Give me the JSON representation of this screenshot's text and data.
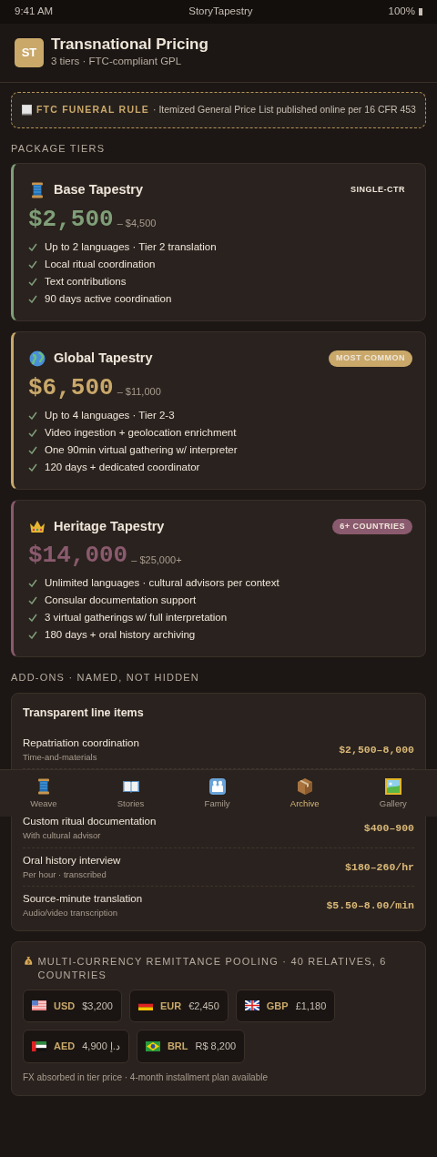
{
  "status_bar": {
    "time": "9:41 AM",
    "app": "StoryTapestry",
    "battery": "100%"
  },
  "header": {
    "avatar": "ST",
    "title": "Transnational Pricing",
    "subtitle": "3 tiers · FTC-compliant GPL"
  },
  "notice": {
    "label": "FTC FUNERAL RULE",
    "text": "· Itemized General Price List published online per 16 CFR 453"
  },
  "tiers_heading": "PACKAGE TIERS",
  "tiers": [
    {
      "kind": "spool",
      "name": "Base Tapestry",
      "badge": {
        "text": "SINGLE-CTR",
        "kind": "plain"
      },
      "color": "#7f9f78",
      "price": "$2,500",
      "price_max": "– $4,500",
      "features": [
        "Up to 2 languages · Tier 2 translation",
        "Local ritual coordination",
        "Text contributions",
        "90 days active coordination"
      ]
    },
    {
      "kind": "globe",
      "name": "Global Tapestry",
      "badge": {
        "text": "MOST COMMON",
        "kind": "pill"
      },
      "color": "#c9a86a",
      "price": "$6,500",
      "price_max": "– $11,000",
      "features": [
        "Up to 4 languages · Tier 2-3",
        "Video ingestion + geolocation enrichment",
        "One 90min virtual gathering w/ interpreter",
        "120 days + dedicated coordinator"
      ]
    },
    {
      "kind": "crown",
      "name": "Heritage Tapestry",
      "badge": {
        "text": "6+ COUNTRIES",
        "kind": "pill"
      },
      "color": "#8a5a6e",
      "price": "$14,000",
      "price_max": "– $25,000+",
      "features": [
        "Unlimited languages · cultural advisors per context",
        "Consular documentation support",
        "3 virtual gatherings w/ full interpretation",
        "180 days + oral history archiving"
      ]
    }
  ],
  "addons_heading": "ADD-ONS · NAMED, NOT HIDDEN",
  "addons": {
    "title": "Transparent line items",
    "items": [
      {
        "name": "Repatriation coordination",
        "note": "Time-and-materials",
        "price": "$2,500–8,000"
      },
      {
        "name": "Custom ritual documentation",
        "note": "With cultural advisor",
        "price": "$400–900"
      },
      {
        "name": "Oral history interview",
        "note": "Per hour · transcribed",
        "price": "$180–260/hr"
      },
      {
        "name": "Source-minute translation",
        "note": "Audio/video transcription",
        "price": "$5.50–8.00/min"
      }
    ]
  },
  "remittance": {
    "title": "MULTI-CURRENCY REMITTANCE POOLING · 40 RELATIVES, 6 COUNTRIES",
    "currencies": [
      {
        "kind": "us",
        "code": "USD",
        "amount": "$3,200"
      },
      {
        "kind": "de",
        "code": "EUR",
        "amount": "€2,450"
      },
      {
        "kind": "gb",
        "code": "GBP",
        "amount": "£1,180"
      },
      {
        "kind": "ae",
        "code": "AED",
        "amount": "4,900 د.إ"
      },
      {
        "kind": "br",
        "code": "BRL",
        "amount": "R$ 8,200"
      }
    ],
    "footnote": "FX absorbed in tier price · 4-month installment plan available"
  },
  "nav": [
    {
      "kind": "spool",
      "label": "Weave",
      "selected": false
    },
    {
      "kind": "book",
      "label": "Stories",
      "selected": false
    },
    {
      "kind": "family",
      "label": "Family",
      "selected": false
    },
    {
      "kind": "box",
      "label": "Archive",
      "selected": true
    },
    {
      "kind": "picture",
      "label": "Gallery",
      "selected": false
    }
  ]
}
